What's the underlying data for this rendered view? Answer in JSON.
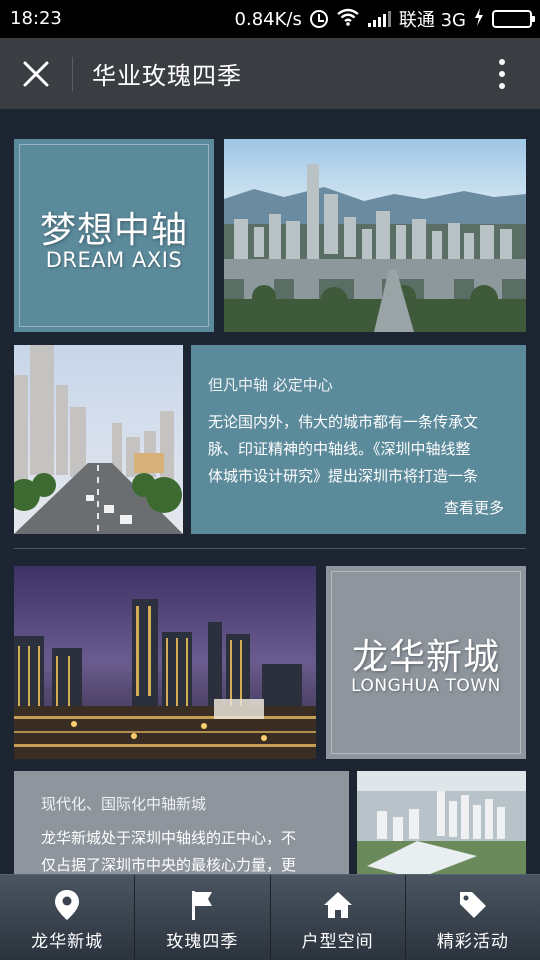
{
  "status_bar": {
    "time": "18:23",
    "speed": "0.84K/s",
    "carrier": "联通 3G",
    "battery_level": 1.0
  },
  "header": {
    "title": "华业玫瑰四季"
  },
  "sections": {
    "dream_axis": {
      "title_cn": "梦想中轴",
      "title_en": "DREAM AXIS",
      "heading": "但凡中轴 必定中心",
      "body_lines": [
        "无论国内外，伟大的城市都有一条传承文",
        "脉、印证精神的中轴线。《深圳中轴线整",
        "体城市设计研究》提出深圳市将打造一条"
      ],
      "more": "查看更多"
    },
    "longhua": {
      "title_cn": "龙华新城",
      "title_en": "LONGHUA TOWN",
      "heading": "现代化、国际化中轴新城",
      "body_lines": [
        "龙华新城处于深圳中轴线的正中心，不",
        "仅占据了深圳市中央的最核心力量，更"
      ]
    }
  },
  "bottom_nav": [
    {
      "label": "龙华新城",
      "icon": "location-pin-icon"
    },
    {
      "label": "玫瑰四季",
      "icon": "flag-icon"
    },
    {
      "label": "户型空间",
      "icon": "home-icon"
    },
    {
      "label": "精彩活动",
      "icon": "tag-icon"
    }
  ],
  "colors": {
    "teal_tile": "#5b8a9b",
    "grey_tile": "#8e959d",
    "background": "#1e2532"
  }
}
